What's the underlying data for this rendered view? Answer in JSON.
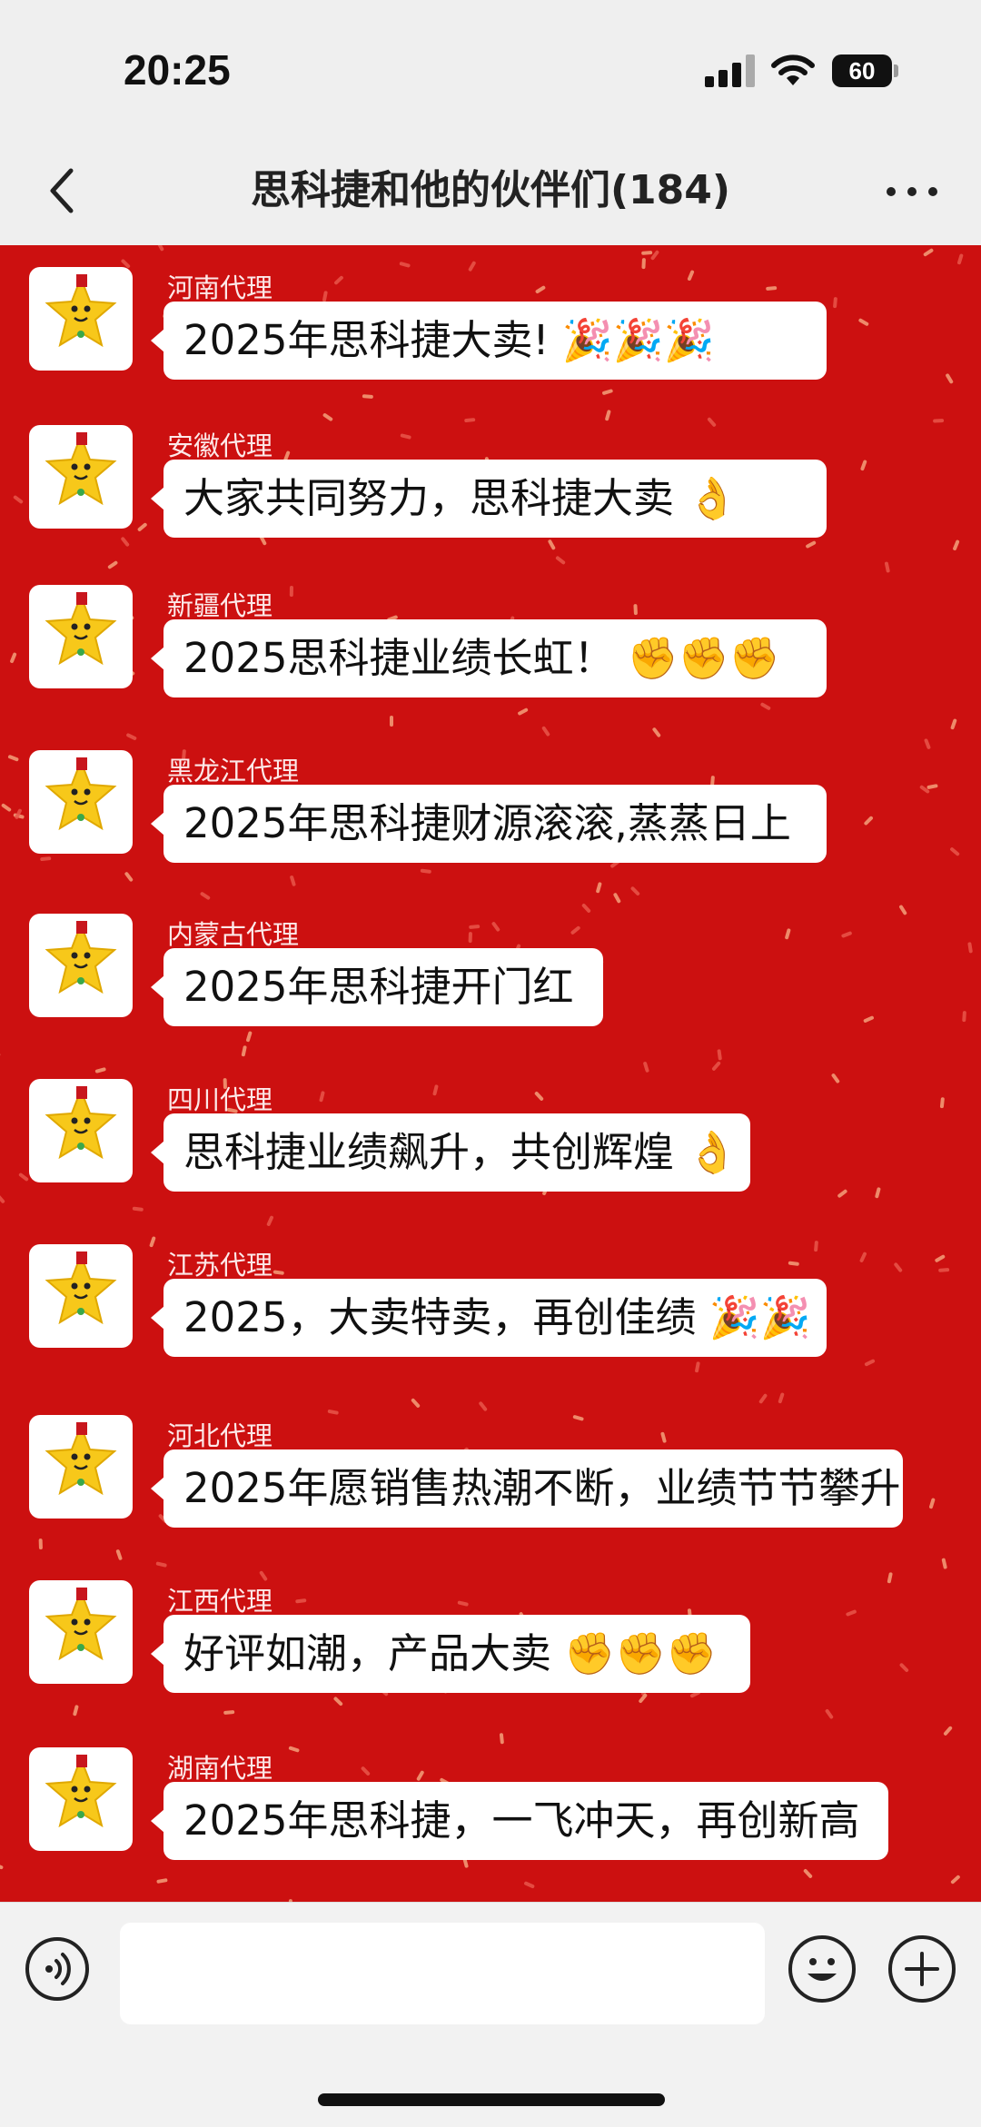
{
  "status_bar": {
    "time": "20:25",
    "battery": "60"
  },
  "header": {
    "title": "思科捷和他的伙伴们(184)"
  },
  "messages": [
    {
      "sender": "河南代理",
      "text": "2025年思科捷大卖!  🎉🎉🎉"
    },
    {
      "sender": "安徽代理",
      "text": "大家共同努力，思科捷大卖  👌"
    },
    {
      "sender": "新疆代理",
      "text": "2025思科捷业绩长虹！   ✊✊✊"
    },
    {
      "sender": "黑龙江代理",
      "text": "2025年思科捷财源滚滚,蒸蒸日上"
    },
    {
      "sender": "内蒙古代理",
      "text": "2025年思科捷开门红"
    },
    {
      "sender": "四川代理",
      "text": "思科捷业绩飙升，共创辉煌  👌"
    },
    {
      "sender": "江苏代理",
      "text": "2025，大卖特卖，再创佳绩  🎉🎉"
    },
    {
      "sender": "河北代理",
      "text": "2025年愿销售热潮不断，业绩节节攀升"
    },
    {
      "sender": "江西代理",
      "text": "好评如潮，产品大卖  ✊✊✊"
    },
    {
      "sender": "湖南代理",
      "text": "2025年思科捷，一飞冲天，再创新高"
    }
  ],
  "input": {
    "value": ""
  },
  "colors": {
    "chat_background": "#cc1010",
    "bubble": "#ffffff",
    "mascot": "#f7c81a"
  }
}
